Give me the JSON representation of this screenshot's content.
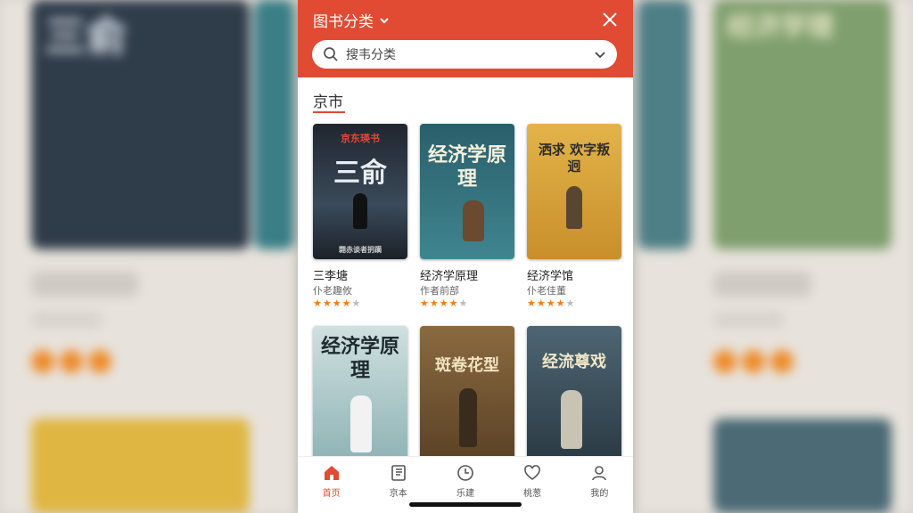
{
  "header": {
    "title": "图书分类",
    "accent": "#e14a33"
  },
  "search": {
    "placeholder": "搜韦分类"
  },
  "section": {
    "title": "京市"
  },
  "books": [
    {
      "title": "三李塘",
      "author": "仆老趣攸",
      "rating": 4,
      "cover_text": "三俞",
      "cover_top": "京东瑛书",
      "cover_bottom": "翾赤谈者抈躏",
      "bg": "#2e3b4a"
    },
    {
      "title": "经济学原理",
      "author": "作者前部",
      "rating": 4,
      "cover_text": "经济学原理",
      "cover_top": "",
      "cover_bottom": "",
      "bg": "#2e6f7a"
    },
    {
      "title": "经济学馆",
      "author": "仆老佳董",
      "rating": 4,
      "cover_text": "洒求 欢字叛迥",
      "cover_top": "",
      "cover_bottom": "",
      "bg": "#d9a637"
    },
    {
      "title": "",
      "author": "",
      "rating": 0,
      "cover_text": "经济学原理",
      "cover_top": "",
      "cover_bottom": "",
      "bg": "#8bb1b6"
    },
    {
      "title": "",
      "author": "",
      "rating": 0,
      "cover_text": "斑卷花型",
      "cover_top": "",
      "cover_bottom": "",
      "bg": "#7b5a33"
    },
    {
      "title": "",
      "author": "",
      "rating": 0,
      "cover_text": "经流尊戏",
      "cover_top": "",
      "cover_bottom": "",
      "bg": "#3a4f5c"
    }
  ],
  "tabs": [
    {
      "label": "首页",
      "icon": "home-icon",
      "active": true
    },
    {
      "label": "京本",
      "icon": "book-icon",
      "active": false
    },
    {
      "label": "乐建",
      "icon": "clock-icon",
      "active": false
    },
    {
      "label": "桃葱",
      "icon": "heart-icon",
      "active": false
    },
    {
      "label": "我的",
      "icon": "user-icon",
      "active": false
    }
  ],
  "background": {
    "left_title": "三俞",
    "right_title": "经济学理"
  }
}
